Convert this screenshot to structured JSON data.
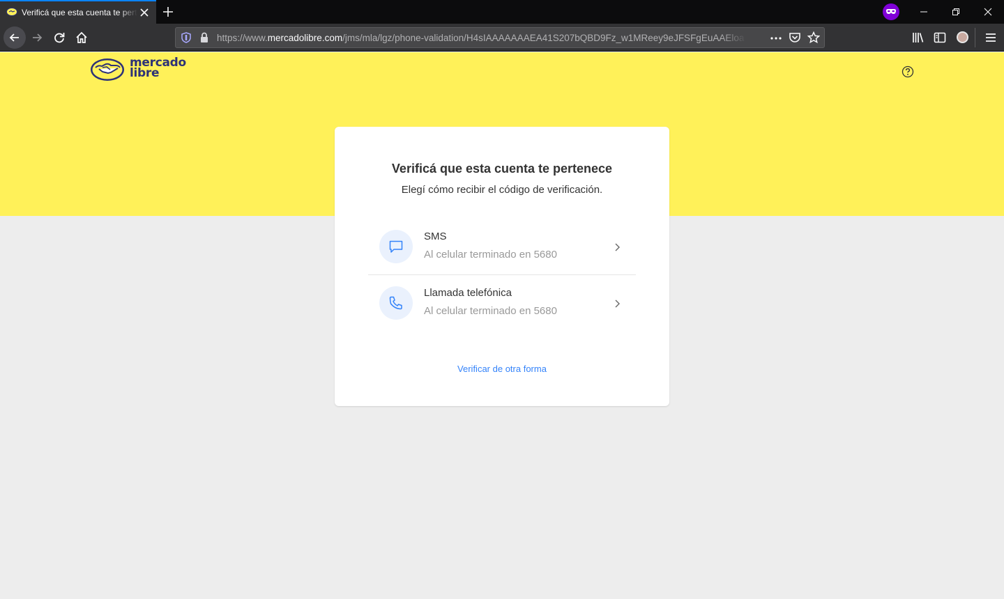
{
  "browser": {
    "tab_title": "Verificá que esta cuenta te pertenece",
    "url_prefix": "https://www.",
    "url_host": "mercadolibre.com",
    "url_path": "/jms/mla/lgz/phone-validation/H4sIAAAAAAAEA41S207bQBD9Fz_w1MReey9eJFSFgEuAAEloa"
  },
  "header": {
    "logo_line1": "mercado",
    "logo_line2": "libre"
  },
  "card": {
    "title": "Verificá que esta cuenta te pertenece",
    "subtitle": "Elegí cómo recibir el código de verificación.",
    "options": [
      {
        "title": "SMS",
        "description": "Al celular terminado en 5680",
        "icon": "chat-bubble-icon"
      },
      {
        "title": "Llamada telefónica",
        "description": "Al celular terminado en 5680",
        "icon": "phone-icon"
      }
    ],
    "other_way_link": "Verificar de otra forma"
  },
  "colors": {
    "brand_yellow": "#fff159",
    "brand_navy": "#2d3277",
    "link_blue": "#3483fa",
    "icon_bg": "#eaf1fd"
  }
}
